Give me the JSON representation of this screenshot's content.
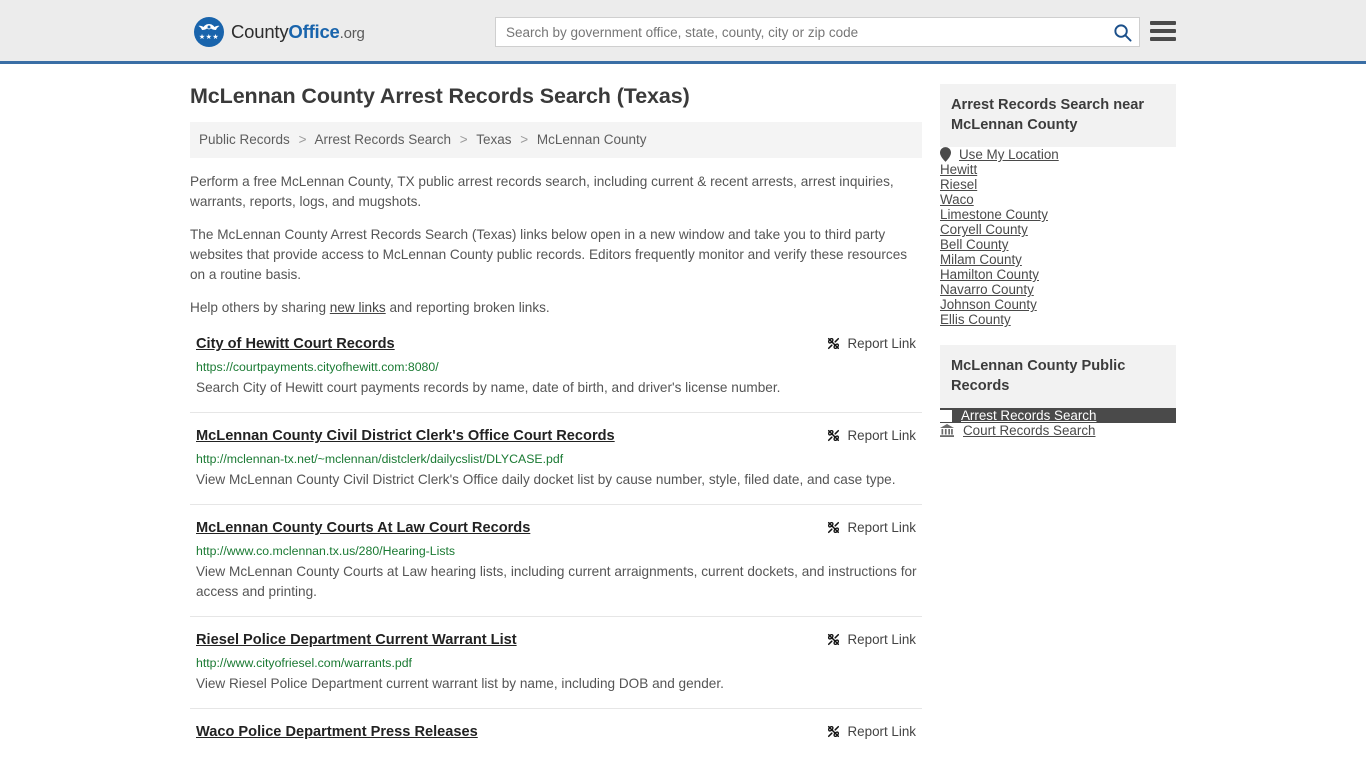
{
  "header": {
    "brand": {
      "part1": "County",
      "part2": "Office",
      "part3": ".org"
    },
    "search": {
      "placeholder": "Search by government office, state, county, city or zip code",
      "value": ""
    },
    "search_icon": "search-icon",
    "menu_icon": "hamburger-menu-icon"
  },
  "main": {
    "title": "McLennan County Arrest Records Search (Texas)",
    "breadcrumb": [
      "Public Records",
      "Arrest Records Search",
      "Texas",
      "McLennan County"
    ],
    "breadcrumb_separator": ">",
    "intro": {
      "p1": "Perform a free McLennan County, TX public arrest records search, including current & recent arrests, arrest inquiries, warrants, reports, logs, and mugshots.",
      "p2": "The McLennan County Arrest Records Search (Texas) links below open in a new window and take you to third party websites that provide access to McLennan County public records. Editors frequently monitor and verify these resources on a routine basis.",
      "p3_before": "Help others by sharing ",
      "p3_link": "new links",
      "p3_after": " and reporting broken links."
    },
    "report_link_label": "Report Link",
    "report_link_icon": "broken-link-icon",
    "results": [
      {
        "title": "City of Hewitt Court Records",
        "url": "https://courtpayments.cityofhewitt.com:8080/",
        "description": "Search City of Hewitt court payments records by name, date of birth, and driver's license number."
      },
      {
        "title": "McLennan County Civil District Clerk's Office Court Records",
        "url": "http://mclennan-tx.net/~mclennan/distclerk/dailycslist/DLYCASE.pdf",
        "description": "View McLennan County Civil District Clerk's Office daily docket list by cause number, style, filed date, and case type."
      },
      {
        "title": "McLennan County Courts At Law Court Records",
        "url": "http://www.co.mclennan.tx.us/280/Hearing-Lists",
        "description": "View McLennan County Courts at Law hearing lists, including current arraignments, current dockets, and instructions for access and printing."
      },
      {
        "title": "Riesel Police Department Current Warrant List",
        "url": "http://www.cityofriesel.com/warrants.pdf",
        "description": "View Riesel Police Department current warrant list by name, including DOB and gender."
      },
      {
        "title": "Waco Police Department Press Releases",
        "url": "",
        "description": ""
      }
    ]
  },
  "sidebar": {
    "near_panel": {
      "heading": "Arrest Records Search near McLennan County",
      "use_my_location": "Use My Location",
      "location_icon": "map-pin-icon",
      "items": [
        "Hewitt",
        "Riesel",
        "Waco",
        "Limestone County",
        "Coryell County",
        "Bell County",
        "Milam County",
        "Hamilton County",
        "Navarro County",
        "Johnson County",
        "Ellis County"
      ]
    },
    "records_panel": {
      "heading": "McLennan County Public Records",
      "items": [
        {
          "label": "Arrest Records Search",
          "icon": "square-icon",
          "active": true
        },
        {
          "label": "Court Records Search",
          "icon": "courthouse-icon",
          "active": false
        }
      ]
    }
  },
  "colors": {
    "brand_blue": "#1964ac",
    "header_border": "#3a6ea5",
    "url_green": "#1a7a33",
    "active_bg": "#4a4a4a"
  }
}
